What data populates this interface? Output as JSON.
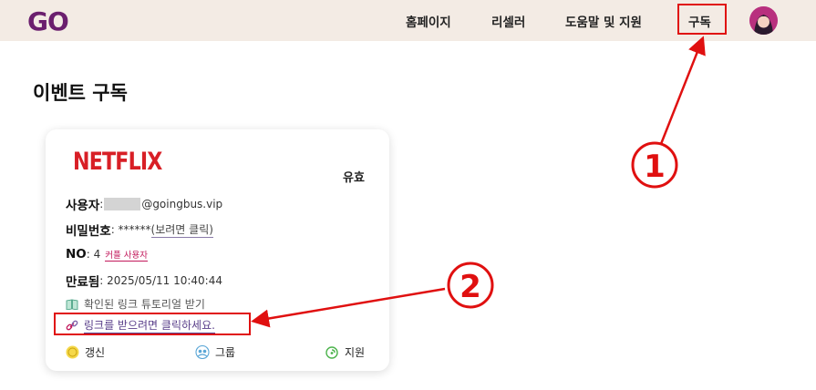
{
  "header": {
    "logo_text": "GO",
    "nav": {
      "home": "홈페이지",
      "reseller": "리셀러",
      "help": "도움말 및 지원",
      "subscription": "구독"
    },
    "brand_color": "#6b1f6e"
  },
  "page": {
    "title": "이벤트 구독"
  },
  "card": {
    "service": "NETFLIX",
    "status": "유효",
    "user_label": "사용자",
    "user_value": "@goingbus.vip",
    "password_label": "비밀번호",
    "password_value": "******",
    "password_link": "(보려면 클릭)",
    "no_label": "NO",
    "no_value": "4",
    "couple_badge": "커플 사용자",
    "expires_label": "만료됨",
    "expires_value": "2025/05/11 10:40:44",
    "tutorial_link": "확인된 링크 튜토리얼 받기",
    "get_link": "링크를 받으려면 클릭하세요.",
    "actions": {
      "renew": "갱신",
      "group": "그룹",
      "support": "지원"
    }
  },
  "annotations": {
    "marker_1": "①",
    "marker_2": "②",
    "color": "#e01010"
  }
}
